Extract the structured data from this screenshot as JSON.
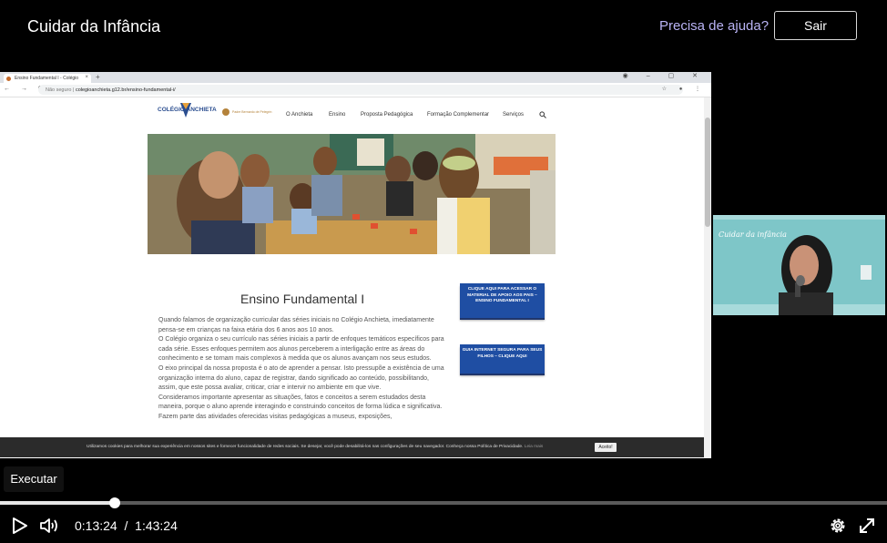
{
  "header": {
    "title": "Cuidar da Infância",
    "help_link": "Precisa de ajuda?",
    "exit_button": "Sair"
  },
  "browser": {
    "tab_title": "Ensino Fundamental I - Colégio",
    "url_secure": "Não seguro",
    "url": "colegioanchieta.g12.br/ensino-fundamental-i/"
  },
  "site": {
    "logo": "COLÉGIO ANCHIETA",
    "logo_sub": "Padre Bernardo de Pelegrin",
    "nav": [
      "O Anchieta",
      "Ensino",
      "Proposta Pedagógica",
      "Formação Complementar",
      "Serviços"
    ],
    "heading": "Ensino Fundamental I",
    "paragraphs": [
      "Quando falamos de organização curricular das séries iniciais no Colégio Anchieta, imediatamente pensa-se em crianças na faixa etária dos 6 anos aos 10 anos.",
      "O Colégio organiza o seu currículo nas séries iniciais a partir de enfoques temáticos específicos para cada série. Esses enfoques permitem aos alunos perceberem a interligação entre as áreas do conhecimento e se tornam mais complexos à medida que os alunos avançam nos seus estudos.",
      "O eixo principal da nossa proposta é o ato de aprender a pensar. Isto pressupõe a existência de uma organização interna do aluno, capaz de registrar, dando significado ao conteúdo, possibilitando, assim, que este possa avaliar, criticar, criar e intervir no ambiente em que vive.",
      "Consideramos importante apresentar as situações, fatos e conceitos a serem estudados desta maneira, porque o aluno aprende interagindo e construindo conceitos de forma lúdica e significativa. Fazem parte das atividades oferecidas visitas pedagógicas a museus, exposições,"
    ],
    "cta1": "CLIQUE AQUI PARA ACESSAR O MATERIAL DE APOIO AOS PAIS – ENSINO FUNDAMENTAL I",
    "cta2": "GUIA INTERNET SEGURA PARA SEUS FILHOS – CLIQUE AQUI",
    "cookie_text": "Utilizamos cookies para melhorar sua experiência em nossos sites e fornecer funcionalidade de redes sociais. Se desejar, você pode desabilitá-los nas configurações de seu navegador. Conheça nossa Política de Privacidade.",
    "cookie_link": "Leia mais",
    "cookie_button": "Aceito!"
  },
  "webcam": {
    "title": "Cuidar da infância"
  },
  "player": {
    "tooltip": "Executar",
    "current_time": "0:13:24",
    "separator": "/",
    "duration": "1:43:24",
    "progress": 0.1296
  },
  "colors": {
    "background": "#000000",
    "help_link": "#b9b3f5",
    "cta_blue": "#1f4ea3",
    "webcam_bg": "#7ec6c8"
  },
  "icons": [
    "play-icon",
    "volume-icon",
    "settings-icon",
    "fullscreen-icon",
    "search-icon"
  ]
}
